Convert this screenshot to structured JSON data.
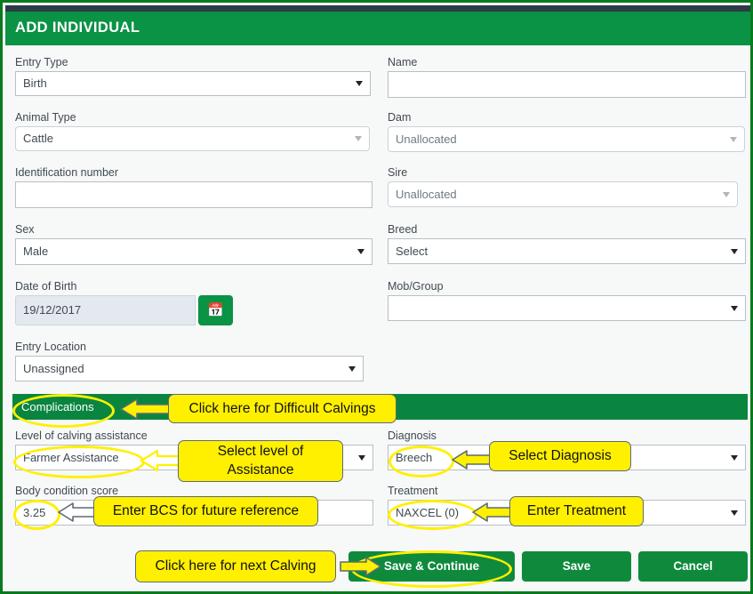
{
  "header": {
    "title": "ADD INDIVIDUAL"
  },
  "form": {
    "left": [
      {
        "label": "Entry Type",
        "value": "Birth",
        "type": "select"
      },
      {
        "label": "Animal Type",
        "value": "Cattle",
        "type": "select"
      },
      {
        "label": "Identification number",
        "value": "",
        "type": "text"
      },
      {
        "label": "Sex",
        "value": "Male",
        "type": "select"
      },
      {
        "label": "Date of Birth",
        "value": "19/12/2017",
        "type": "date"
      },
      {
        "label": "Entry Location",
        "value": "Unassigned",
        "type": "select"
      }
    ],
    "right": [
      {
        "label": "Name",
        "value": "",
        "type": "text"
      },
      {
        "label": "Dam",
        "value": "Unallocated",
        "type": "select"
      },
      {
        "label": "Sire",
        "value": "Unallocated",
        "type": "select"
      },
      {
        "label": "Breed",
        "value": "Select",
        "type": "select"
      },
      {
        "label": "Mob/Group",
        "value": "",
        "type": "select"
      }
    ],
    "date_picker_icon": "calendar-icon"
  },
  "complications": {
    "bar_label": "Complications",
    "fields": [
      {
        "label": "Level of calving assistance",
        "value": "Farmer Assistance"
      },
      {
        "label": "Diagnosis",
        "value": "Breech"
      },
      {
        "label": "Body condition score",
        "value": "3.25"
      },
      {
        "label": "Treatment",
        "value": "NAXCEL (0)"
      }
    ]
  },
  "buttons": {
    "save_continue": "Save & Continue",
    "save": "Save",
    "cancel": "Cancel"
  },
  "annotations": [
    {
      "text": "Click here for Difficult Calvings"
    },
    {
      "text": "Select level of Assistance"
    },
    {
      "text": "Select Diagnosis"
    },
    {
      "text": "Enter BCS for future reference"
    },
    {
      "text": "Enter Treatment"
    },
    {
      "text": "Click here for next Calving"
    }
  ],
  "colors": {
    "brand_green": "#0a9245",
    "bar_green": "#0a8540",
    "button_green": "#0f8a3c",
    "highlight_yellow": "#fff000",
    "frame_green": "#0a7a1e"
  }
}
